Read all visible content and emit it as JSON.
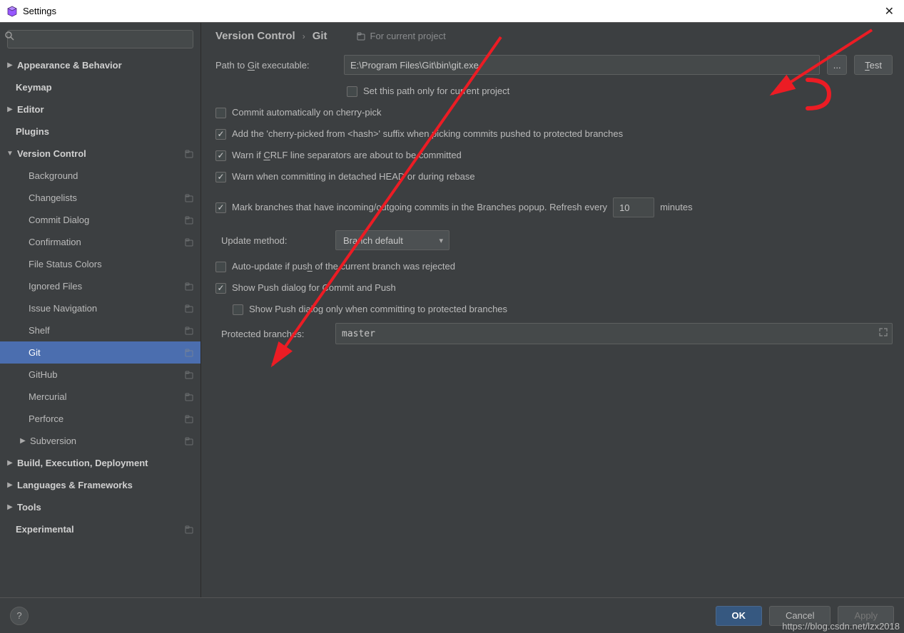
{
  "window": {
    "title": "Settings"
  },
  "search": {
    "placeholder": ""
  },
  "sidebar": {
    "items": [
      {
        "label": "Appearance & Behavior",
        "bold": true,
        "arrow": "right",
        "level": 0,
        "badge": false
      },
      {
        "label": "Keymap",
        "bold": true,
        "arrow": null,
        "level": 0,
        "badge": false
      },
      {
        "label": "Editor",
        "bold": true,
        "arrow": "right",
        "level": 0,
        "badge": false
      },
      {
        "label": "Plugins",
        "bold": true,
        "arrow": null,
        "level": 0,
        "badge": false
      },
      {
        "label": "Version Control",
        "bold": true,
        "arrow": "down",
        "level": 0,
        "badge": true
      },
      {
        "label": "Background",
        "bold": false,
        "arrow": null,
        "level": 1,
        "badge": false
      },
      {
        "label": "Changelists",
        "bold": false,
        "arrow": null,
        "level": 1,
        "badge": true
      },
      {
        "label": "Commit Dialog",
        "bold": false,
        "arrow": null,
        "level": 1,
        "badge": true
      },
      {
        "label": "Confirmation",
        "bold": false,
        "arrow": null,
        "level": 1,
        "badge": true
      },
      {
        "label": "File Status Colors",
        "bold": false,
        "arrow": null,
        "level": 1,
        "badge": false
      },
      {
        "label": "Ignored Files",
        "bold": false,
        "arrow": null,
        "level": 1,
        "badge": true
      },
      {
        "label": "Issue Navigation",
        "bold": false,
        "arrow": null,
        "level": 1,
        "badge": true
      },
      {
        "label": "Shelf",
        "bold": false,
        "arrow": null,
        "level": 1,
        "badge": true
      },
      {
        "label": "Git",
        "bold": false,
        "arrow": null,
        "level": 1,
        "badge": true,
        "selected": true
      },
      {
        "label": "GitHub",
        "bold": false,
        "arrow": null,
        "level": 1,
        "badge": true
      },
      {
        "label": "Mercurial",
        "bold": false,
        "arrow": null,
        "level": 1,
        "badge": true
      },
      {
        "label": "Perforce",
        "bold": false,
        "arrow": null,
        "level": 1,
        "badge": true
      },
      {
        "label": "Subversion",
        "bold": false,
        "arrow": "right",
        "level": 1,
        "badge": true
      },
      {
        "label": "Build, Execution, Deployment",
        "bold": true,
        "arrow": "right",
        "level": 0,
        "badge": false
      },
      {
        "label": "Languages & Frameworks",
        "bold": true,
        "arrow": "right",
        "level": 0,
        "badge": false
      },
      {
        "label": "Tools",
        "bold": true,
        "arrow": "right",
        "level": 0,
        "badge": false
      },
      {
        "label": "Experimental",
        "bold": true,
        "arrow": null,
        "level": 0,
        "badge": true
      }
    ]
  },
  "breadcrumb": {
    "root": "Version Control",
    "leaf": "Git",
    "scope": "For current project"
  },
  "form": {
    "path_label": "Path to Git executable:",
    "path_value": "E:\\Program Files\\Git\\bin\\git.exe",
    "browse_label": "...",
    "test_label": "Test",
    "set_path_project": {
      "checked": false,
      "label": "Set this path only for current project"
    },
    "commit_auto_cherry": {
      "checked": false,
      "label": "Commit automatically on cherry-pick"
    },
    "add_cherry_suffix": {
      "checked": true,
      "label": "Add the 'cherry-picked from <hash>' suffix when picking commits pushed to protected branches"
    },
    "warn_crlf": {
      "checked": true,
      "label": "Warn if CRLF line separators are about to be committed"
    },
    "warn_detached": {
      "checked": true,
      "label": "Warn when committing in detached HEAD or during rebase"
    },
    "mark_branches": {
      "checked": true,
      "label_before": "Mark branches that have incoming/outgoing commits in the Branches popup.  Refresh every",
      "value": "10",
      "label_after": "minutes"
    },
    "update_method_label": "Update method:",
    "update_method_value": "Branch default",
    "auto_update_push": {
      "checked": false,
      "label": "Auto-update if push of the current branch was rejected"
    },
    "show_push_dialog": {
      "checked": true,
      "label": "Show Push dialog for Commit and Push"
    },
    "show_push_protected": {
      "checked": false,
      "label": "Show Push dialog only when committing to protected branches"
    },
    "protected_branches_label": "Protected branches:",
    "protected_branches_value": "master"
  },
  "footer": {
    "help": "?",
    "ok": "OK",
    "cancel": "Cancel",
    "apply": "Apply"
  },
  "watermark": "https://blog.csdn.net/lzx2018"
}
